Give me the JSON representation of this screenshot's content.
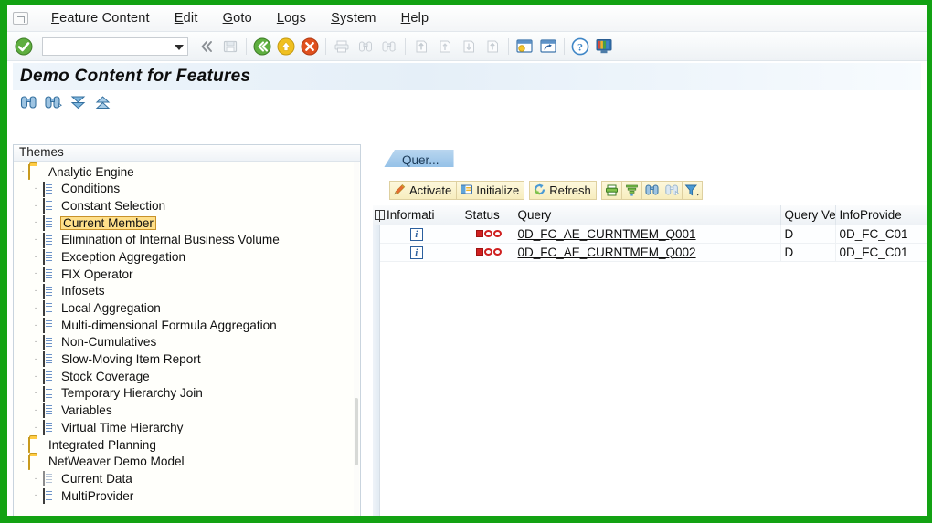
{
  "window": {
    "system_menu_icon": "system-menu-icon"
  },
  "menubar": {
    "items": [
      {
        "label": "Feature Content",
        "mnemonic": "F"
      },
      {
        "label": "Edit",
        "mnemonic": "E"
      },
      {
        "label": "Goto",
        "mnemonic": "G"
      },
      {
        "label": "Logs",
        "mnemonic": "L"
      },
      {
        "label": "System",
        "mnemonic": "S"
      },
      {
        "label": "Help",
        "mnemonic": "H"
      }
    ]
  },
  "toolbar": {
    "command_field_value": "",
    "command_field_placeholder": "",
    "icons": [
      "enter-check-icon",
      "command-dropdown-icon",
      "back-chevrons-icon",
      "save-icon",
      "back-green-icon",
      "exit-yellow-icon",
      "cancel-red-icon",
      "print-icon",
      "find-icon",
      "find-next-icon",
      "first-page-icon",
      "previous-page-icon",
      "next-page-icon",
      "last-page-icon",
      "create-session-icon",
      "create-shortcut-icon",
      "help-icon",
      "customize-layout-icon"
    ]
  },
  "title": {
    "text": "Demo Content for Features"
  },
  "app_toolbar": {
    "buttons": [
      {
        "name": "find-icon",
        "tooltip": "Find"
      },
      {
        "name": "find-next-icon",
        "tooltip": "Find Next"
      },
      {
        "name": "expand-all-icon",
        "tooltip": "Expand All"
      },
      {
        "name": "collapse-all-icon",
        "tooltip": "Collapse All"
      }
    ]
  },
  "tree": {
    "header": "Themes",
    "selected_node": "Current Member",
    "nodes": [
      {
        "label": "Analytic Engine",
        "level": 1,
        "icon": "folder-open-icon",
        "expanded": true
      },
      {
        "label": "Conditions",
        "level": 2,
        "icon": "document-icon"
      },
      {
        "label": "Constant Selection",
        "level": 2,
        "icon": "document-icon"
      },
      {
        "label": "Current Member",
        "level": 2,
        "icon": "document-icon",
        "selected": true
      },
      {
        "label": "Elimination of Internal Business Volume",
        "level": 2,
        "icon": "document-icon"
      },
      {
        "label": "Exception Aggregation",
        "level": 2,
        "icon": "document-icon"
      },
      {
        "label": "FIX Operator",
        "level": 2,
        "icon": "document-icon"
      },
      {
        "label": "Infosets",
        "level": 2,
        "icon": "document-icon"
      },
      {
        "label": "Local Aggregation",
        "level": 2,
        "icon": "document-icon"
      },
      {
        "label": "Multi-dimensional Formula Aggregation",
        "level": 2,
        "icon": "document-icon"
      },
      {
        "label": "Non-Cumulatives",
        "level": 2,
        "icon": "document-icon"
      },
      {
        "label": "Slow-Moving Item Report",
        "level": 2,
        "icon": "document-icon"
      },
      {
        "label": "Stock Coverage",
        "level": 2,
        "icon": "document-icon"
      },
      {
        "label": "Temporary Hierarchy Join",
        "level": 2,
        "icon": "document-icon"
      },
      {
        "label": "Variables",
        "level": 2,
        "icon": "document-icon"
      },
      {
        "label": "Virtual Time Hierarchy",
        "level": 2,
        "icon": "document-icon"
      },
      {
        "label": "Integrated Planning",
        "level": 1,
        "icon": "folder-closed-icon"
      },
      {
        "label": "NetWeaver Demo Model",
        "level": 1,
        "icon": "folder-open-icon",
        "expanded": true
      },
      {
        "label": "Current Data",
        "level": 2,
        "icon": "document-grey-icon"
      },
      {
        "label": "MultiProvider",
        "level": 2,
        "icon": "document-icon"
      }
    ]
  },
  "right_panel": {
    "tabs": [
      {
        "label": "Quer...",
        "active": true
      }
    ],
    "alv_toolbar": {
      "buttons": [
        {
          "label": "Activate",
          "icon": "pencil-icon"
        },
        {
          "label": "Initialize",
          "icon": "initialize-icon"
        },
        {
          "label": "Refresh",
          "icon": "refresh-icon"
        }
      ],
      "icon_buttons": [
        {
          "name": "print-preview-icon"
        },
        {
          "name": "sort-filter-icon"
        },
        {
          "name": "find-icon"
        },
        {
          "name": "find-next-icon"
        },
        {
          "name": "filter-icon"
        }
      ]
    },
    "table": {
      "columns": [
        "Informati",
        "Status",
        "Query",
        "Query Ve",
        "InfoProvide"
      ],
      "rows": [
        {
          "information": "i",
          "status": "not-linked-icon",
          "query": "0D_FC_AE_CURNTMEM_Q001",
          "query_version": "D",
          "infoprovider": "0D_FC_C01",
          "selected": true
        },
        {
          "information": "i",
          "status": "not-linked-icon",
          "query": "0D_FC_AE_CURNTMEM_Q002",
          "query_version": "D",
          "infoprovider": "0D_FC_C01",
          "selected": false
        }
      ]
    }
  },
  "colors": {
    "frame_green": "#13a213",
    "selection_yellow": "#ffe08a",
    "tab_blue": "#8dbde6",
    "alv_button_cream": "#f7edbe",
    "status_red": "#cf2020"
  }
}
